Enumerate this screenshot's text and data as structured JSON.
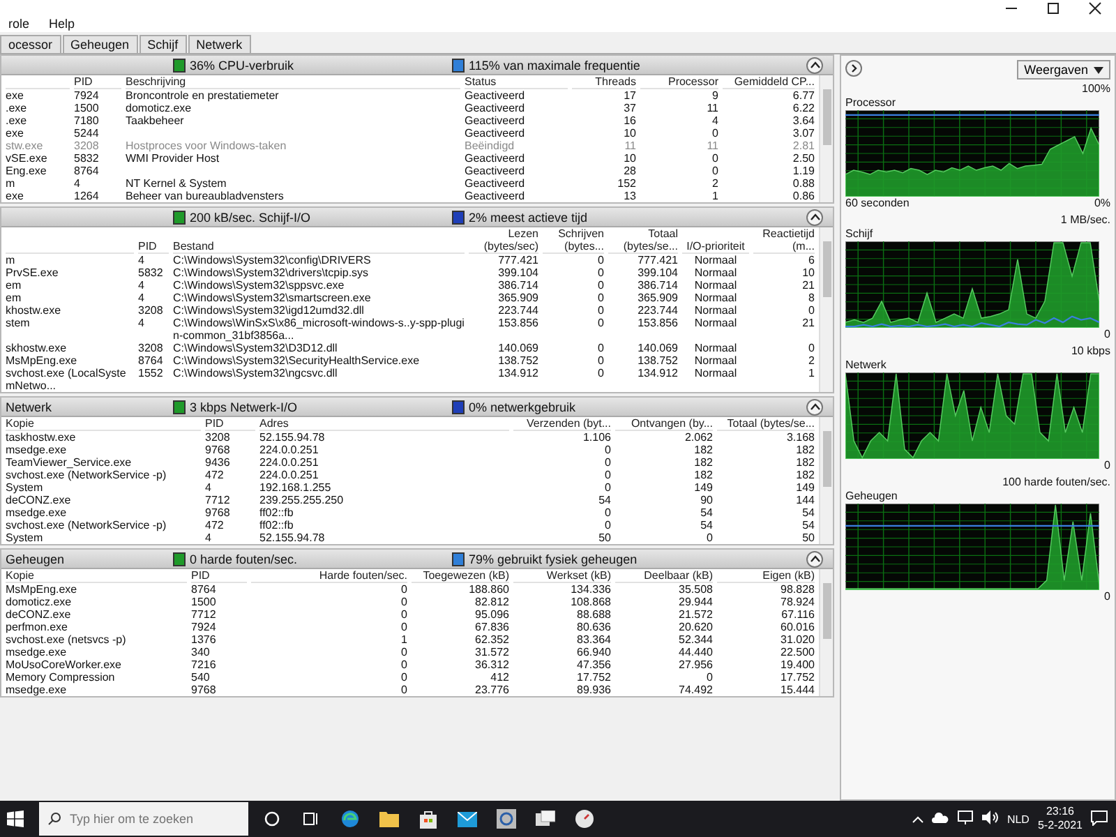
{
  "window": {
    "menu": [
      "role",
      "Help"
    ]
  },
  "tabs": [
    {
      "label": "ocessor",
      "selected": false
    },
    {
      "label": "Geheugen",
      "selected": false
    },
    {
      "label": "Schijf",
      "selected": false
    },
    {
      "label": "Netwerk",
      "selected": false
    }
  ],
  "sections": [
    {
      "kind": "cpu",
      "metrics": [
        {
          "text": "36% CPU-verbruik",
          "color": "#1f9a2a"
        },
        {
          "text": "115% van maximale frequentie",
          "color": "#2f7fd8"
        }
      ],
      "columns": [
        {
          "kind": "text"
        },
        {
          "label": "PID",
          "kind": "text"
        },
        {
          "label": "Beschrijving",
          "kind": "text"
        },
        {
          "label": "Status",
          "kind": "text"
        },
        {
          "label": "Threads",
          "kind": "number"
        },
        {
          "label": "Processor",
          "kind": "number"
        },
        {
          "label": "Gemiddeld CP...",
          "kind": "number"
        }
      ],
      "rows": [
        {
          "ended": false,
          "cells": [
            "exe",
            "7924",
            "Broncontrole en prestatiemeter",
            "Geactiveerd",
            "17",
            "9",
            "6.77"
          ]
        },
        {
          "ended": false,
          "cells": [
            ".exe",
            "1500",
            "domoticz.exe",
            "Geactiveerd",
            "37",
            "11",
            "6.22"
          ]
        },
        {
          "ended": false,
          "cells": [
            ".exe",
            "7180",
            "Taakbeheer",
            "Geactiveerd",
            "16",
            "4",
            "3.64"
          ]
        },
        {
          "ended": false,
          "cells": [
            "exe",
            "5244",
            null,
            "Geactiveerd",
            "10",
            "0",
            "3.07"
          ]
        },
        {
          "ended": true,
          "cells": [
            "stw.exe",
            "3208",
            "Hostproces voor Windows-taken",
            "Beëindigd",
            "11",
            "11",
            "2.81"
          ]
        },
        {
          "ended": false,
          "cells": [
            "vSE.exe",
            "5832",
            "WMI Provider Host",
            "Geactiveerd",
            "10",
            "0",
            "2.50"
          ]
        },
        {
          "ended": false,
          "cells": [
            "Eng.exe",
            "8764",
            null,
            "Geactiveerd",
            "28",
            "0",
            "1.19"
          ]
        },
        {
          "ended": false,
          "cells": [
            "m",
            "4",
            "NT Kernel & System",
            "Geactiveerd",
            "152",
            "2",
            "0.88"
          ]
        },
        {
          "ended": false,
          "cells": [
            "exe",
            "1264",
            "Beheer van bureaubladvensters",
            "Geactiveerd",
            "13",
            "1",
            "0.86"
          ]
        }
      ]
    },
    {
      "kind": "disk",
      "metrics": [
        {
          "text": "200 kB/sec. Schijf-I/O",
          "color": "#1f9a2a"
        },
        {
          "text": "2% meest actieve tijd",
          "color": "#1f3fb8"
        }
      ],
      "columns": [
        {
          "kind": "text"
        },
        {
          "label": "PID",
          "kind": "text"
        },
        {
          "label": "Bestand",
          "kind": "text"
        },
        {
          "label": "Lezen (bytes/sec)",
          "kind": "number"
        },
        {
          "label": "Schrijven (bytes...",
          "kind": "number"
        },
        {
          "label": "Totaal (bytes/se...",
          "kind": "number"
        },
        {
          "label": "I/O-prioriteit",
          "kind": "center"
        },
        {
          "label": "Reactietijd (m...",
          "kind": "number"
        }
      ],
      "rows": [
        {
          "cells": [
            "m",
            "4",
            "C:\\Windows\\System32\\config\\DRIVERS",
            "777.421",
            "0",
            "777.421",
            "Normaal",
            "6"
          ]
        },
        {
          "cells": [
            "PrvSE.exe",
            "5832",
            "C:\\Windows\\System32\\drivers\\tcpip.sys",
            "399.104",
            "0",
            "399.104",
            "Normaal",
            "10"
          ]
        },
        {
          "cells": [
            "em",
            "4",
            "C:\\Windows\\System32\\sppsvc.exe",
            "386.714",
            "0",
            "386.714",
            "Normaal",
            "21"
          ]
        },
        {
          "cells": [
            "em",
            "4",
            "C:\\Windows\\System32\\smartscreen.exe",
            "365.909",
            "0",
            "365.909",
            "Normaal",
            "8"
          ]
        },
        {
          "cells": [
            "khostw.exe",
            "3208",
            "C:\\Windows\\System32\\igd12umd32.dll",
            "223.744",
            "0",
            "223.744",
            "Normaal",
            "0"
          ]
        },
        {
          "cells": [
            "stem",
            "4",
            "C:\\Windows\\WinSxS\\x86_microsoft-windows-s..y-spp-plugin-common_31bf3856a...",
            "153.856",
            "0",
            "153.856",
            "Normaal",
            "21"
          ]
        },
        {
          "cells": [
            "skhostw.exe",
            "3208",
            "C:\\Windows\\System32\\D3D12.dll",
            "140.069",
            "0",
            "140.069",
            "Normaal",
            "0"
          ]
        },
        {
          "cells": [
            "MsMpEng.exe",
            "8764",
            "C:\\Windows\\System32\\SecurityHealthService.exe",
            "138.752",
            "0",
            "138.752",
            "Normaal",
            "2"
          ]
        },
        {
          "cells": [
            "svchost.exe (LocalSystemNetwo...",
            "1552",
            "C:\\Windows\\System32\\ngcsvc.dll",
            "134.912",
            "0",
            "134.912",
            "Normaal",
            "1"
          ]
        }
      ]
    },
    {
      "kind": "network",
      "title": "Netwerk",
      "metrics": [
        {
          "text": "3 kbps Netwerk-I/O",
          "color": "#1f9a2a"
        },
        {
          "text": "0% netwerkgebruik",
          "color": "#1f3fb8"
        }
      ],
      "columns": [
        {
          "label": "Kopie",
          "kind": "text"
        },
        {
          "label": "PID",
          "kind": "text"
        },
        {
          "label": "Adres",
          "kind": "text"
        },
        {
          "label": "Verzenden (byt...",
          "kind": "number"
        },
        {
          "label": "Ontvangen (by...",
          "kind": "number"
        },
        {
          "label": "Totaal (bytes/se...",
          "kind": "number"
        }
      ],
      "rows": [
        {
          "cells": [
            "taskhostw.exe",
            "3208",
            "52.155.94.78",
            "1.106",
            "2.062",
            "3.168"
          ]
        },
        {
          "cells": [
            "msedge.exe",
            "9768",
            "224.0.0.251",
            "0",
            "182",
            "182"
          ]
        },
        {
          "cells": [
            "TeamViewer_Service.exe",
            "9436",
            "224.0.0.251",
            "0",
            "182",
            "182"
          ]
        },
        {
          "cells": [
            "svchost.exe (NetworkService -p)",
            "472",
            "224.0.0.251",
            "0",
            "182",
            "182"
          ]
        },
        {
          "cells": [
            "System",
            "4",
            "192.168.1.255",
            "0",
            "149",
            "149"
          ]
        },
        {
          "cells": [
            "deCONZ.exe",
            "7712",
            "239.255.255.250",
            "54",
            "90",
            "144"
          ]
        },
        {
          "cells": [
            "msedge.exe",
            "9768",
            "ff02::fb",
            "0",
            "54",
            "54"
          ]
        },
        {
          "cells": [
            "svchost.exe (NetworkService -p)",
            "472",
            "ff02::fb",
            "0",
            "54",
            "54"
          ]
        },
        {
          "cells": [
            "System",
            "4",
            "52.155.94.78",
            "50",
            "0",
            "50"
          ]
        }
      ]
    },
    {
      "kind": "memory",
      "title": "Geheugen",
      "metrics": [
        {
          "text": "0 harde fouten/sec.",
          "color": "#1f9a2a"
        },
        {
          "text": "79% gebruikt fysiek geheugen",
          "color": "#2f7fd8"
        }
      ],
      "columns": [
        {
          "label": "Kopie",
          "kind": "text"
        },
        {
          "label": "PID",
          "kind": "text"
        },
        {
          "label": "Harde fouten/sec.",
          "kind": "number"
        },
        {
          "label": "Toegewezen (kB)",
          "kind": "number"
        },
        {
          "label": "Werkset (kB)",
          "kind": "number"
        },
        {
          "label": "Deelbaar (kB)",
          "kind": "number"
        },
        {
          "label": "Eigen (kB)",
          "kind": "number"
        }
      ],
      "rows": [
        {
          "cells": [
            "MsMpEng.exe",
            "8764",
            "0",
            "188.860",
            "134.336",
            "35.508",
            "98.828"
          ]
        },
        {
          "cells": [
            "domoticz.exe",
            "1500",
            "0",
            "82.812",
            "108.868",
            "29.944",
            "78.924"
          ]
        },
        {
          "cells": [
            "deCONZ.exe",
            "7712",
            "0",
            "95.096",
            "88.688",
            "21.572",
            "67.116"
          ]
        },
        {
          "cells": [
            "perfmon.exe",
            "7924",
            "0",
            "67.836",
            "80.636",
            "20.620",
            "60.016"
          ]
        },
        {
          "cells": [
            "svchost.exe (netsvcs -p)",
            "1376",
            "1",
            "62.352",
            "83.364",
            "52.344",
            "31.020"
          ]
        },
        {
          "cells": [
            "msedge.exe",
            "340",
            "0",
            "31.572",
            "66.940",
            "44.440",
            "22.500"
          ]
        },
        {
          "cells": [
            "MoUsoCoreWorker.exe",
            "7216",
            "0",
            "36.312",
            "47.356",
            "27.956",
            "19.400"
          ]
        },
        {
          "cells": [
            "Memory Compression",
            "540",
            "0",
            "412",
            "17.752",
            "0",
            "17.752"
          ]
        },
        {
          "cells": [
            "msedge.exe",
            "9768",
            "0",
            "23.776",
            "89.936",
            "74.492",
            "15.444"
          ]
        }
      ]
    }
  ],
  "side": {
    "views_button": "Weergaven",
    "graphs": [
      {
        "kind": "processor",
        "title": "Processor",
        "top_label": "100%",
        "bottom_label": "0%",
        "time_label": "60 seconden"
      },
      {
        "kind": "disk",
        "title": "Schijf",
        "top_label": "1 MB/sec.",
        "bottom_label": "0"
      },
      {
        "kind": "network",
        "title": "Netwerk",
        "top_label": "10 kbps",
        "bottom_label": "0"
      },
      {
        "kind": "memory",
        "title": "Geheugen",
        "top_label": "100 harde fouten/sec.",
        "bottom_label": "0"
      }
    ]
  },
  "taskbar": {
    "search_placeholder": "Typ hier om te zoeken",
    "language": "NLD",
    "time": "23:16",
    "date": "5-2-2021"
  }
}
